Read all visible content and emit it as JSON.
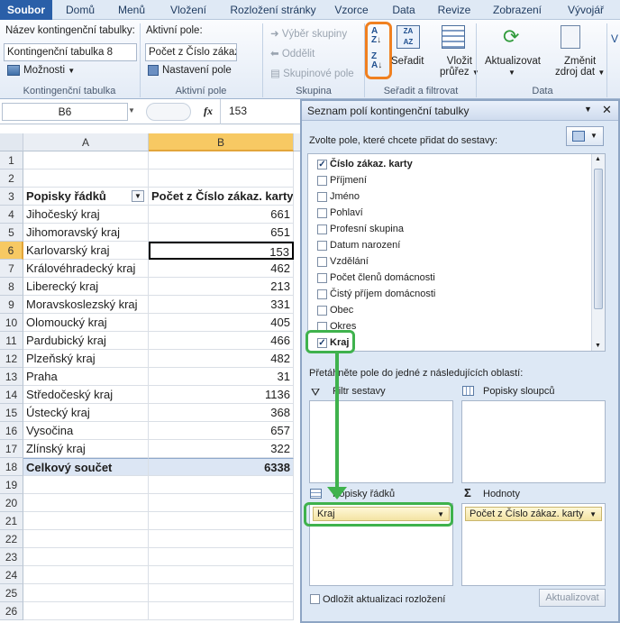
{
  "ribbon_tabs": [
    "Soubor",
    "Domů",
    "Menů",
    "Vložení",
    "Rozložení stránky",
    "Vzorce",
    "Data",
    "Revize",
    "Zobrazení",
    "Vývojář"
  ],
  "ribbon": {
    "pt_name_label": "Název kontingenční tabulky:",
    "pt_name_value": "Kontingenční tabulka 8",
    "options_label": "Možnosti",
    "pt_group": "Kontingenční tabulka",
    "active_field_label": "Aktivní pole:",
    "active_field_value": "Počet z Číslo zákaz.",
    "field_settings": "Nastavení pole",
    "active_group": "Aktivní pole",
    "group_selection": "Výběr skupiny",
    "ungroup": "Oddělit",
    "group_field": "Skupinové pole",
    "group_group": "Skupina",
    "sort_label": "Seřadit",
    "slicer_label1": "Vložit",
    "slicer_label2": "průřez",
    "sort_group": "Seřadit a filtrovat",
    "refresh_label": "Aktualizovat",
    "change_source1": "Změnit",
    "change_source2": "zdroj dat",
    "data_group": "Data"
  },
  "formula_bar": {
    "name_box": "B6",
    "fx": "fx",
    "value": "153"
  },
  "sheet": {
    "columns": [
      "A",
      "B"
    ],
    "rows": [
      "1",
      "2",
      "3",
      "4",
      "5",
      "6",
      "7",
      "8",
      "9",
      "10",
      "11",
      "12",
      "13",
      "14",
      "15",
      "16",
      "17",
      "18",
      "19",
      "20",
      "21",
      "22",
      "23",
      "24",
      "25",
      "26"
    ],
    "header_a": "Popisky řádků",
    "header_b": "Počet z Číslo zákaz. karty",
    "data": [
      [
        "Jihočeský kraj",
        "661"
      ],
      [
        "Jihomoravský kraj",
        "651"
      ],
      [
        "Karlovarský kraj",
        "153"
      ],
      [
        "Královéhradecký kraj",
        "462"
      ],
      [
        "Liberecký kraj",
        "213"
      ],
      [
        "Moravskoslezský kraj",
        "331"
      ],
      [
        "Olomoucký kraj",
        "405"
      ],
      [
        "Pardubický kraj",
        "466"
      ],
      [
        "Plzeňský kraj",
        "482"
      ],
      [
        "Praha",
        "31"
      ],
      [
        "Středočeský kraj",
        "1136"
      ],
      [
        "Ústecký kraj",
        "368"
      ],
      [
        "Vysočina",
        "657"
      ],
      [
        "Zlínský kraj",
        "322"
      ]
    ],
    "total_label": "Celkový součet",
    "total_value": "6338"
  },
  "pane": {
    "title": "Seznam polí kontingenční tabulky",
    "choose_text": "Zvolte pole, které chcete přidat do sestavy:",
    "fields": [
      {
        "label": "Číslo zákaz. karty",
        "checked": true
      },
      {
        "label": "Příjmení",
        "checked": false
      },
      {
        "label": "Jméno",
        "checked": false
      },
      {
        "label": "Pohlaví",
        "checked": false
      },
      {
        "label": "Profesní skupina",
        "checked": false
      },
      {
        "label": "Datum narození",
        "checked": false
      },
      {
        "label": "Vzdělání",
        "checked": false
      },
      {
        "label": "Počet členů domácnosti",
        "checked": false
      },
      {
        "label": "Čistý příjem domácnosti",
        "checked": false
      },
      {
        "label": "Obec",
        "checked": false
      },
      {
        "label": "Okres",
        "checked": false
      },
      {
        "label": "Kraj",
        "checked": true
      }
    ],
    "drag_text": "Přetáhněte pole do jedné z následujících oblastí:",
    "filter_area": "Filtr sestavy",
    "columns_area": "Popisky sloupců",
    "rows_area": "Popisky řádků",
    "values_area": "Hodnoty",
    "rows_item": "Kraj",
    "values_item": "Počet z Číslo zákaz. karty",
    "defer_label": "Odložit aktualizaci rozložení",
    "update_button": "Aktualizovat"
  },
  "colors": {
    "accent": "#2a5fa8",
    "highlight_green": "#3fb24d",
    "highlight_orange": "#f08020",
    "active_col": "#f7c963"
  }
}
